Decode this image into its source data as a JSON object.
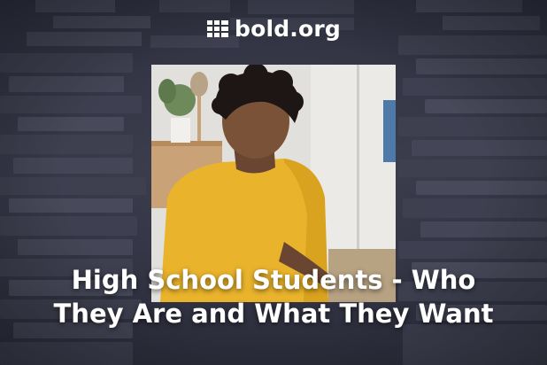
{
  "brand": {
    "name": "bold.org",
    "icon": "bold-grid-icon"
  },
  "headline": {
    "line1": "High School Students - Who",
    "line2": "They Are and What They Want"
  },
  "photo": {
    "subject": "student-reading-photo"
  },
  "colors": {
    "background": "#3a3b4a",
    "text": "#ffffff",
    "shirt": "#e9b32c"
  }
}
